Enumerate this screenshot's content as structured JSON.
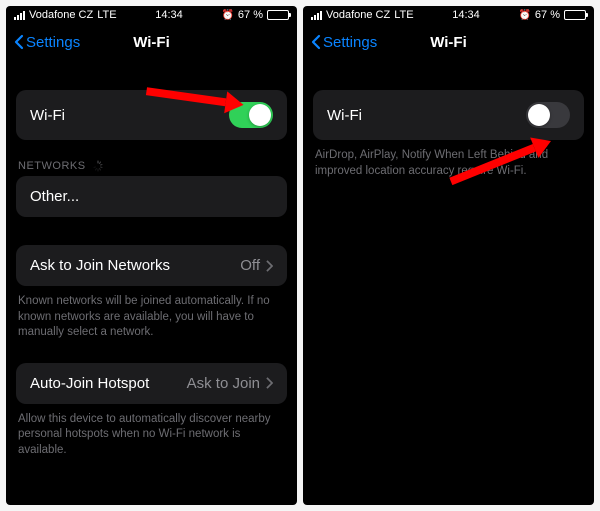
{
  "statusbar": {
    "carrier": "Vodafone CZ",
    "network": "LTE",
    "time": "14:34",
    "battery_pct": "67 %",
    "battery_fill": "67%"
  },
  "nav": {
    "back": "Settings",
    "title": "Wi-Fi"
  },
  "left": {
    "wifi_label": "Wi-Fi",
    "networks_header": "NETWORKS",
    "other_label": "Other...",
    "ask_join_label": "Ask to Join Networks",
    "ask_join_value": "Off",
    "ask_join_footer": "Known networks will be joined automatically. If no known networks are available, you will have to manually select a network.",
    "auto_join_label": "Auto-Join Hotspot",
    "auto_join_value": "Ask to Join",
    "auto_join_footer": "Allow this device to automatically discover nearby personal hotspots when no Wi-Fi network is available."
  },
  "right": {
    "wifi_label": "Wi-Fi",
    "disabled_footer": "AirDrop, AirPlay, Notify When Left Behind and improved location accuracy require Wi-Fi."
  },
  "colors": {
    "accent": "#0a84ff",
    "switch_on": "#30d158",
    "arrow": "#ff0000"
  }
}
